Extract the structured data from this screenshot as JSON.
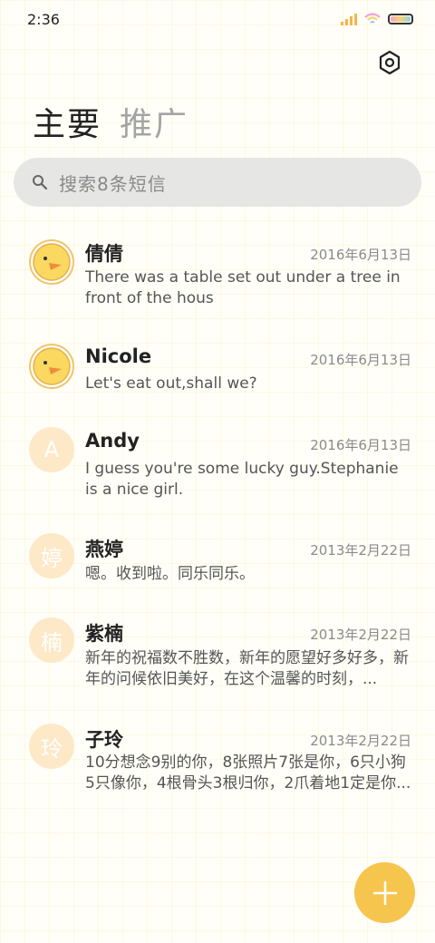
{
  "status_bar": {
    "time": "2:36",
    "battery_level": 1.0
  },
  "tabs": [
    {
      "label": "主要",
      "active": true
    },
    {
      "label": "推广",
      "active": false
    }
  ],
  "search": {
    "placeholder": "搜索8条短信"
  },
  "conversations": [
    {
      "name": "倩倩",
      "date": "2016年6月13日",
      "preview": "There was a table set out under a tree in front of the hous",
      "avatar": "duck-avatar",
      "avatar_letter": ""
    },
    {
      "name": "Nicole",
      "date": "2016年6月13日",
      "preview": "Let's eat out,shall we?",
      "avatar": "duck-avatar",
      "avatar_letter": ""
    },
    {
      "name": "Andy",
      "date": "2016年6月13日",
      "preview": "I guess you're some lucky guy.Stephanie is a nice girl.",
      "avatar": "letter",
      "avatar_letter": "A"
    },
    {
      "name": "燕婷",
      "date": "2013年2月22日",
      "preview": "嗯。收到啦。同乐同乐。",
      "avatar": "letter",
      "avatar_letter": "婷"
    },
    {
      "name": "紫楠",
      "date": "2013年2月22日",
      "preview": "新年的祝福数不胜数，新年的愿望好多好多，新年的问候依旧美好，在这个温馨的时刻，...",
      "avatar": "letter",
      "avatar_letter": "楠"
    },
    {
      "name": "子玲",
      "date": "2013年2月22日",
      "preview": "10分想念9别的你，8张照片7张是你，6只小狗5只像你，4根骨头3根归你，2爪着地1定是你...",
      "avatar": "letter",
      "avatar_letter": "玲"
    }
  ],
  "colors": {
    "accent": "#f6c54e",
    "avatar_letter_bg": "#fde9c8"
  },
  "icons": {
    "settings": "settings-icon",
    "search": "search-icon",
    "compose": "plus-icon"
  }
}
